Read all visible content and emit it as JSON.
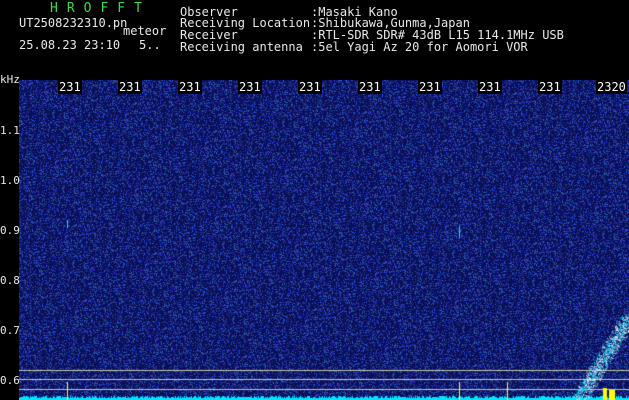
{
  "header": {
    "logo": "HROFFT",
    "filename": "UT2508232310.pn",
    "mode": "meteor",
    "datetime": "25.08.23 23:10",
    "extra": "5.."
  },
  "info": [
    {
      "label": "Observer",
      "value": ":Masaki Kano"
    },
    {
      "label": "Receiving Location",
      "value": ":Shibukawa,Gunma,Japan"
    },
    {
      "label": "Receiver",
      "value": ":RTL-SDR SDR# 43dB L15 114.1MHz USB"
    },
    {
      "label": "Receiving antenna",
      "value": ":5el Yagi Az 20 for Aomori VOR"
    }
  ],
  "yaxis": {
    "unit": "kHz",
    "ticks": [
      "1.1",
      "1.0",
      "0.9",
      "0.8",
      "0.7",
      "0.6"
    ]
  },
  "xaxis": {
    "ticks": [
      "231",
      "231",
      "231",
      "231",
      "231",
      "231",
      "231",
      "231",
      "231",
      "2320"
    ]
  },
  "colors": {
    "background": "#000000",
    "waterfall": "#0a0f5a",
    "noise": "#2a3cc8",
    "signal": "#00e5ff",
    "marker": "#ffff00",
    "text": "#e8e8e8",
    "logo": "#39d94a"
  }
}
